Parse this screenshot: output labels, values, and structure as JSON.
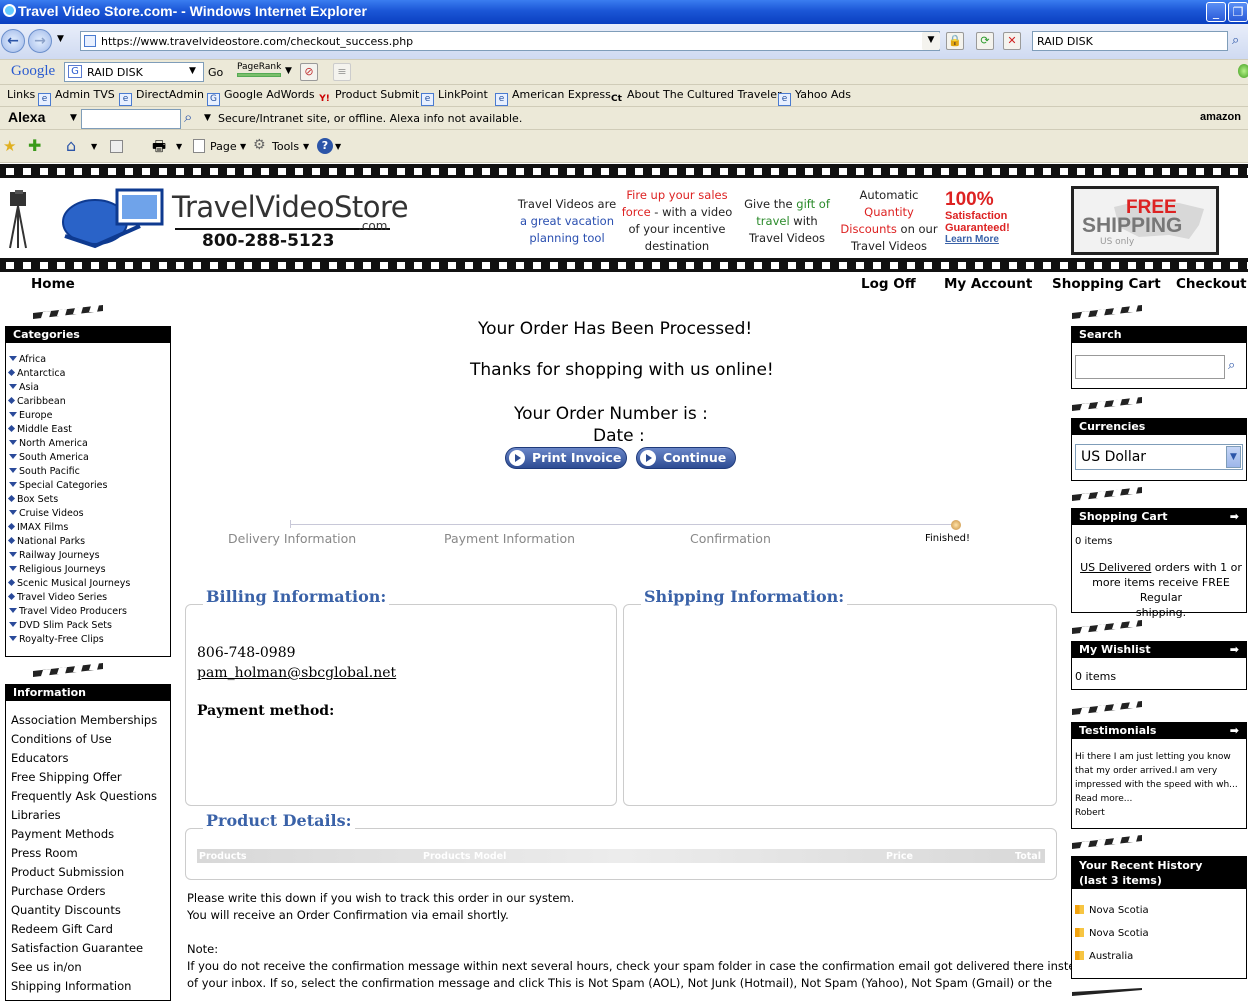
{
  "window": {
    "title": "Travel Video Store.com- - Windows Internet Explorer"
  },
  "browser": {
    "url": "https://www.travelvideostore.com/checkout_success.php",
    "search_value": "RAID DISK",
    "google_label": "Google",
    "google_search_value": "RAID DISK",
    "go_label": "Go",
    "pagerank_label": "PageRank",
    "links_label": "Links",
    "links": [
      "Admin TVS",
      "DirectAdmin",
      "Google AdWords",
      "Product Submit",
      "LinkPoint",
      "American Express",
      "About The Cultured Traveler",
      "Yahoo Ads"
    ],
    "alexa_label": "Alexa",
    "alexa_status": "Secure/Intranet site, or offline. Alexa info not available.",
    "amazon_label": "amazon",
    "page_menu": "Page",
    "tools_menu": "Tools"
  },
  "site": {
    "logo_name": "TravelVideoStore",
    "logo_com": ".com",
    "phone": "800-288-5123",
    "promo1_a": "Travel Videos are",
    "promo1_b": "a great vacation",
    "promo1_c": "planning tool",
    "promo2_a": "Fire up your sales",
    "promo2_b": "force",
    "promo2_c": " - with a video",
    "promo2_d": "of your incentive",
    "promo2_e": "destination",
    "promo3_a": "Give the ",
    "promo3_b": "gift of",
    "promo3_c": "travel",
    "promo3_d": " with",
    "promo3_e": "Travel Videos",
    "promo4_a": "Automatic",
    "promo4_b": "Quantity",
    "promo4_c": "Discounts",
    "promo4_d": " on our",
    "promo4_e": "Travel Videos",
    "sat_pct": "100%",
    "sat_line1": "Satisfaction",
    "sat_line2": "Guaranteed!",
    "sat_learn": "Learn More",
    "ship_free": "FREE",
    "ship_word": "SHIPPING",
    "ship_us": "US only"
  },
  "nav": {
    "home": "Home",
    "logoff": "Log Off",
    "account": "My Account",
    "cart": "Shopping Cart",
    "checkout": "Checkout"
  },
  "categories": {
    "title": "Categories",
    "items": [
      "Africa",
      "Antarctica",
      "Asia",
      "Caribbean",
      "Europe",
      "Middle East",
      "North America",
      "South America",
      "South Pacific",
      "Special Categories",
      "Box Sets",
      "Cruise Videos",
      "IMAX Films",
      "National Parks",
      "Railway Journeys",
      "Religious Journeys",
      "Scenic Musical Journeys",
      "Travel Video Series",
      "Travel Video Producers",
      "DVD Slim Pack Sets",
      "Royalty-Free Clips"
    ]
  },
  "information": {
    "title": "Information",
    "items": [
      "Association Memberships",
      "Conditions of Use",
      "Educators",
      "Free Shipping Offer",
      "Frequently Ask Questions",
      "Libraries",
      "Payment Methods",
      "Press Room",
      "Product Submission",
      "Purchase Orders",
      "Quantity Discounts",
      "Redeem Gift Card",
      "Satisfaction Guarantee",
      "See us in/on",
      "Shipping Information"
    ]
  },
  "main": {
    "processed": "Your Order Has Been Processed!",
    "thanks": "Thanks for shopping with us online!",
    "order_number": "Your Order Number is :",
    "date": "Date :",
    "print_invoice": "Print Invoice",
    "continue": "Continue",
    "steps": [
      "Delivery Information",
      "Payment Information",
      "Confirmation",
      "Finished!"
    ],
    "billing_title": "Billing Information:",
    "shipping_title": "Shipping Information:",
    "phone": "806-748-0989",
    "email": "pam_holman@sbcglobal.net",
    "payment_method": "Payment method:",
    "product_title": "Product Details:",
    "col_products": "Products",
    "col_model": "Products Model",
    "col_price": "Price",
    "col_total": "Total",
    "note1": "Please write this down if you wish to track this order in our system.",
    "note2": "You will receive an Order Confirmation via email shortly.",
    "note_label": "Note:",
    "note3": "If you do not receive the confirmation message within next several hours, check your spam folder in case the confirmation email got delivered there instead",
    "note4": "of your inbox. If so, select the confirmation message and click This is Not Spam (AOL), Not Junk (Hotmail), Not Spam (Yahoo), Not Spam (Gmail) or the"
  },
  "right": {
    "search_title": "Search",
    "currencies_title": "Currencies",
    "currency_value": "US Dollar",
    "cart_title": "Shopping Cart",
    "cart_items": "0 items",
    "cart_us": "US Delivered",
    "cart_msg1": " orders with 1 or",
    "cart_msg2": "more items receive FREE Regular",
    "cart_msg3": "shipping.",
    "wishlist_title": "My Wishlist",
    "wishlist_items": "0 items",
    "testimonials_title": "Testimonials",
    "testimonial1": "Hi there I am just letting you know",
    "testimonial2": "that my order arrived.I am very",
    "testimonial3": "impressed with the speed with wh...",
    "read_more": "Read more...",
    "testimonial_author": "Robert",
    "history_title1": "Your Recent History",
    "history_title2": "(last 3 items)",
    "history": [
      "Nova Scotia",
      "Nova Scotia",
      "Australia"
    ]
  }
}
